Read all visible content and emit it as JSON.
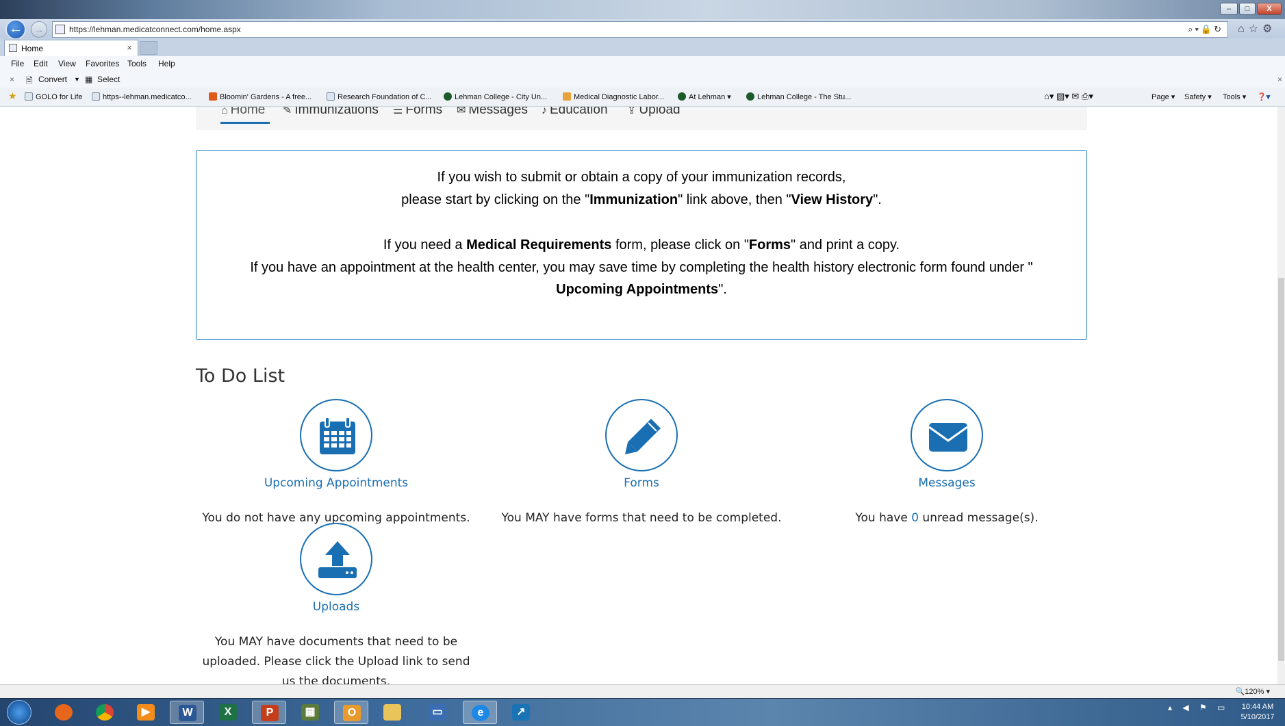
{
  "browser": {
    "url": "https://lehman.medicatconnect.com/home.aspx",
    "tab_title": "Home",
    "tab_close": "×",
    "menu": [
      "File",
      "Edit",
      "View",
      "Favorites",
      "Tools",
      "Help"
    ],
    "commands": {
      "close": "×",
      "convert": "Convert",
      "select": "Select"
    },
    "favorites": [
      "GOLO for Life",
      "https--lehman.medicatco...",
      "Bloomin' Gardens - A free...",
      "Research Foundation of C...",
      "Lehman College - City Un...",
      "Medical Diagnostic Labor...",
      "At Lehman",
      "Lehman College - The Stu..."
    ],
    "toolbar_right": [
      "Page",
      "Safety",
      "Tools"
    ],
    "zoom": "120%",
    "window_buttons": {
      "minimize": "–",
      "restore": "□",
      "close": "X"
    }
  },
  "site_nav": {
    "items": [
      "Home",
      "Immunizations",
      "Forms",
      "Messages",
      "Education",
      "Upload"
    ]
  },
  "notice": {
    "line1": "If you wish to submit or obtain a copy of your immunization records,",
    "line2_a": "please start by clicking on the \"",
    "line2_b": "Immunization",
    "line2_c": "\" link above, then \"",
    "line2_d": "View History",
    "line2_e": "\".",
    "line3_a": "If you need a ",
    "line3_b": "Medical Requirements",
    "line3_c": " form, please click on \"",
    "line3_d": "Forms",
    "line3_e": "\" and print a copy.",
    "line4": "If you have an appointment at the health center, you may save time by completing the health history electronic form found under \"",
    "line5_a": "Upcoming Appointments",
    "line5_b": "\"."
  },
  "todo": {
    "title": "To Do List",
    "cards": [
      {
        "label": "Upcoming Appointments",
        "icon": "calendar-icon",
        "desc": "You do not have any upcoming appointments."
      },
      {
        "label": "Forms",
        "icon": "pencil-icon",
        "desc": "You MAY have forms that need to be completed."
      },
      {
        "label": "Messages",
        "icon": "envelope-icon",
        "desc_a": "You have ",
        "count": "0",
        "desc_b": " unread message(s)."
      },
      {
        "label": "Uploads",
        "icon": "upload-icon",
        "desc": "You MAY have documents that need to be uploaded. Please click the Upload link to send us the documents."
      }
    ]
  },
  "taskbar": {
    "clock_time": "10:44 AM",
    "clock_date": "5/10/2017"
  },
  "colors": {
    "link": "#1a6fb3",
    "notice_border": "#1a7bbf"
  }
}
